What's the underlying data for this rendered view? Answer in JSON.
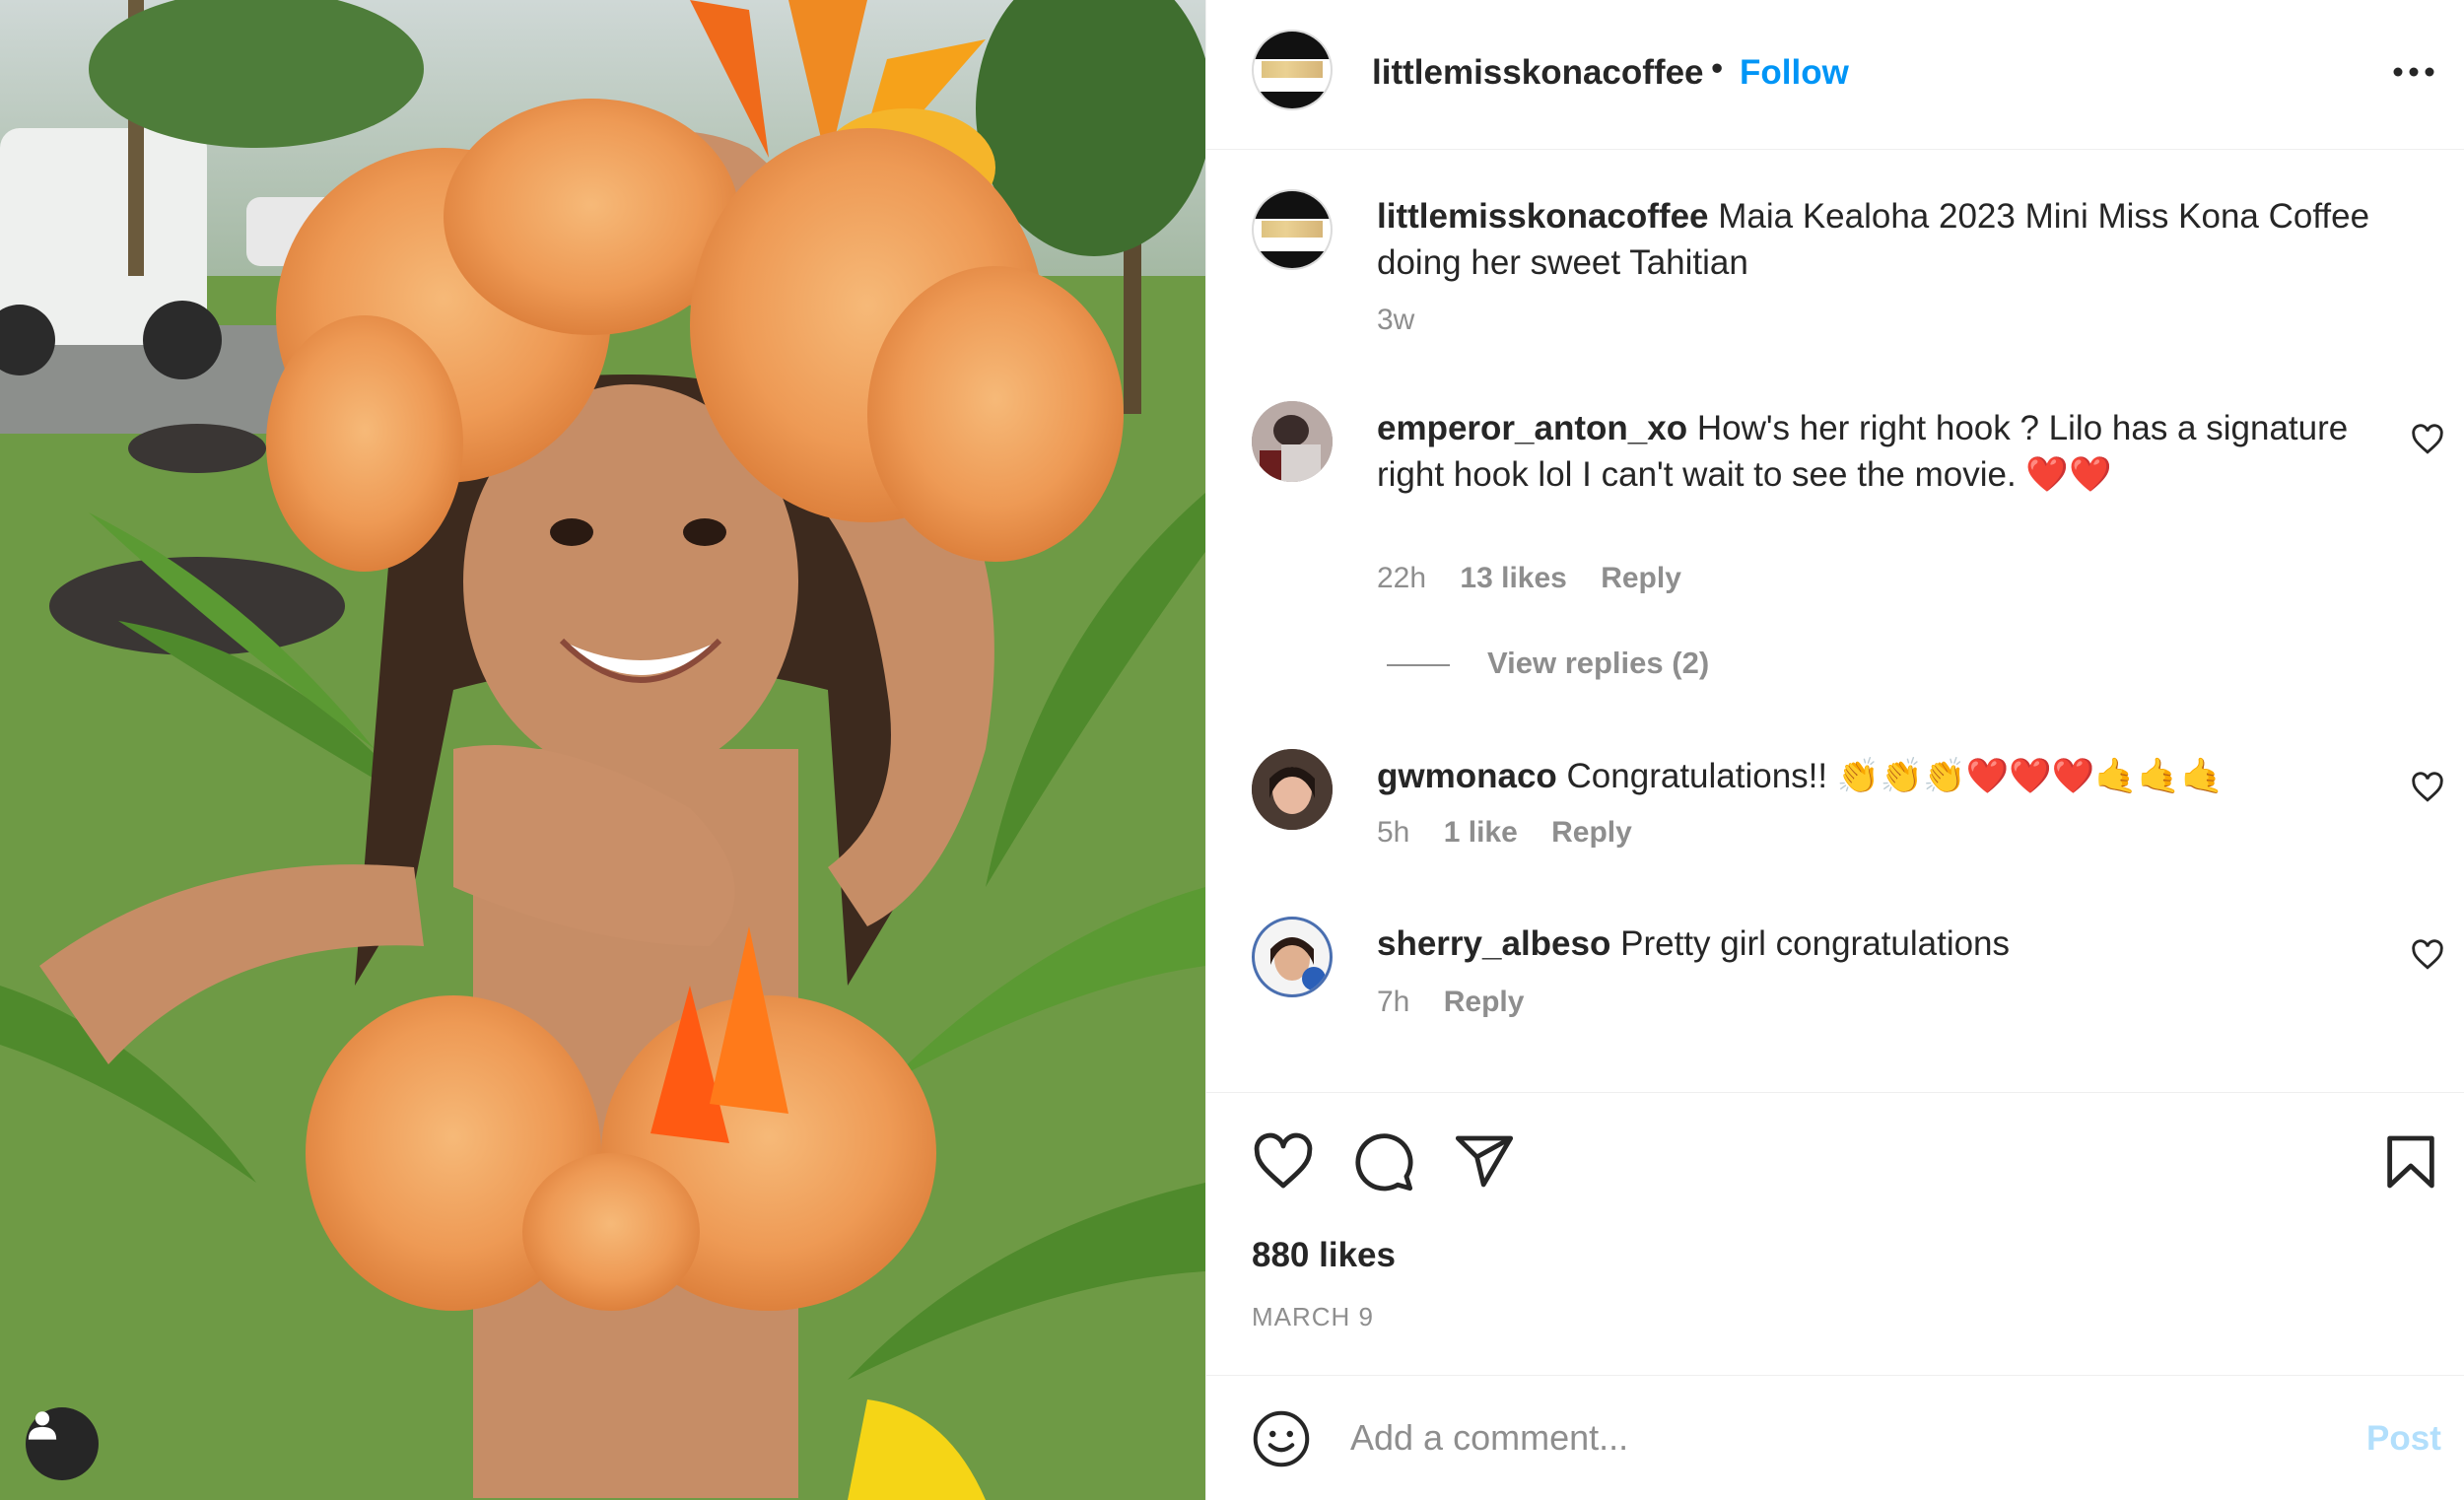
{
  "post": {
    "image_alt": "Girl in orange bougainvillea headdress and top doing a Tahitian dance pose",
    "username": "littlemisskonacoffee",
    "separator": "•",
    "follow_label": "Follow",
    "more_icon": "more-horizontal-icon"
  },
  "caption": {
    "username": "littlemisskonacoffee",
    "text": "Maia Kealoha 2023 Mini Miss Kona Coffee doing her sweet Tahitian",
    "time": "3w"
  },
  "comments": [
    {
      "username": "emperor_anton_xo",
      "text": "How's her right hook ? Lilo has a signature right hook lol I can't wait to see the movie.",
      "emoji": "❤️❤️",
      "time": "22h",
      "likes": "13 likes",
      "reply_label": "Reply",
      "avatar_color": "#9a8a86"
    },
    {
      "username": "gwmonaco",
      "text": "Congratulations!!",
      "emoji": "👏👏👏❤️❤️❤️🤙🤙🤙",
      "time": "5h",
      "likes": "1 like",
      "reply_label": "Reply",
      "avatar_color": "#5a4338"
    },
    {
      "username": "sherry_albeso",
      "text": "Pretty girl congratulations",
      "time": "7h",
      "reply_label": "Reply",
      "avatar_color": "#4a6fb0"
    }
  ],
  "view_replies_label": "View replies (2)",
  "actions": {
    "like_icon": "heart-icon",
    "comment_icon": "comment-icon",
    "share_icon": "send-icon",
    "save_icon": "bookmark-icon",
    "likes_count": "880 likes",
    "date": "MARCH 9"
  },
  "add_comment": {
    "emoji_icon": "smiley-icon",
    "placeholder": "Add a comment...",
    "post_label": "Post"
  },
  "colors": {
    "link_blue": "#0095f6",
    "post_disabled": "#b2dffc",
    "secondary_text": "#8e8e8e",
    "primary_text": "#262626"
  }
}
